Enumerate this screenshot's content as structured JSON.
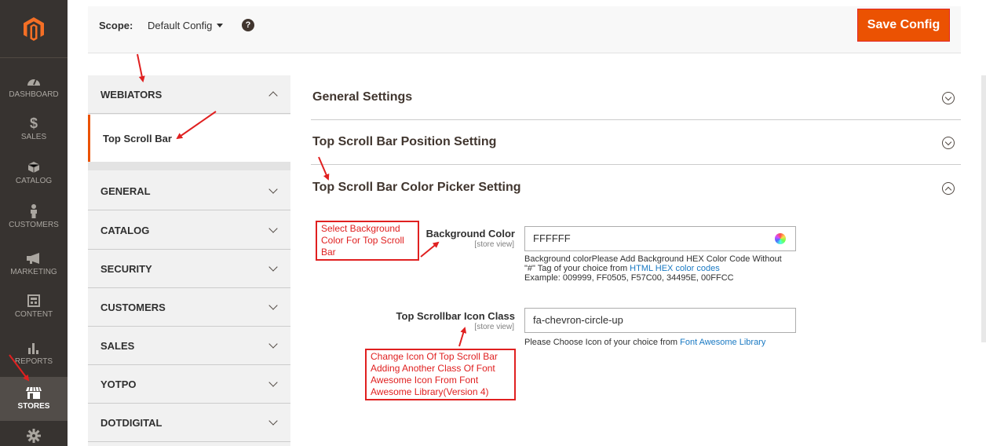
{
  "nav": {
    "items": [
      {
        "label": "DASHBOARD",
        "icon": "dashboard-gauge-icon"
      },
      {
        "label": "SALES",
        "icon": "dollar-icon"
      },
      {
        "label": "CATALOG",
        "icon": "cube-icon"
      },
      {
        "label": "CUSTOMERS",
        "icon": "person-icon"
      },
      {
        "label": "MARKETING",
        "icon": "megaphone-icon"
      },
      {
        "label": "CONTENT",
        "icon": "layout-icon"
      },
      {
        "label": "REPORTS",
        "icon": "bar-chart-icon"
      },
      {
        "label": "STORES",
        "icon": "storefront-icon"
      },
      {
        "label": "",
        "icon": "gear-icon"
      }
    ],
    "active": "STORES"
  },
  "header": {
    "scope_label": "Scope:",
    "scope_value": "Default Config",
    "help": "?",
    "save_label": "Save Config"
  },
  "tabs": {
    "groups": [
      "WEBIATORS",
      "GENERAL",
      "CATALOG",
      "SECURITY",
      "CUSTOMERS",
      "SALES",
      "YOTPO",
      "DOTDIGITAL"
    ],
    "expanded": "WEBIATORS",
    "sub_item": "Top Scroll Bar"
  },
  "sections": [
    {
      "title": "General Settings",
      "state": "collapsed"
    },
    {
      "title": "Top Scroll Bar Position Setting",
      "state": "collapsed"
    },
    {
      "title": "Top Scroll Bar Color Picker Setting",
      "state": "expanded"
    }
  ],
  "fields": {
    "bg_color": {
      "label": "Background Color",
      "scope": "[store view]",
      "value": "FFFFFF",
      "note_line1": "Background colorPlease Add Background HEX Color Code Without",
      "note_line2_pre": "\"#\" Tag of your choice from ",
      "note_line2_link": "HTML HEX color codes",
      "note_line3": "Example: 009999, FF0505, F57C00, 34495E, 00FFCC"
    },
    "icon_class": {
      "label": "Top Scrollbar Icon Class",
      "scope": "[store view]",
      "value": "fa-chevron-circle-up",
      "note_pre": "Please Choose Icon of your choice from ",
      "note_link": "Font Awesome Library"
    }
  },
  "annotations": {
    "bg": [
      "Select Background",
      "Color For Top Scroll",
      "Bar"
    ],
    "icon": [
      "Change Icon Of Top Scroll Bar",
      "Adding Another Class Of Font",
      "Awesome Icon From Font",
      "Awesome Library(Version 4)"
    ]
  },
  "colors": {
    "accent": "#eb5202",
    "nav_bg": "#373330",
    "annotation": "#e02020",
    "link": "#1979c3"
  }
}
